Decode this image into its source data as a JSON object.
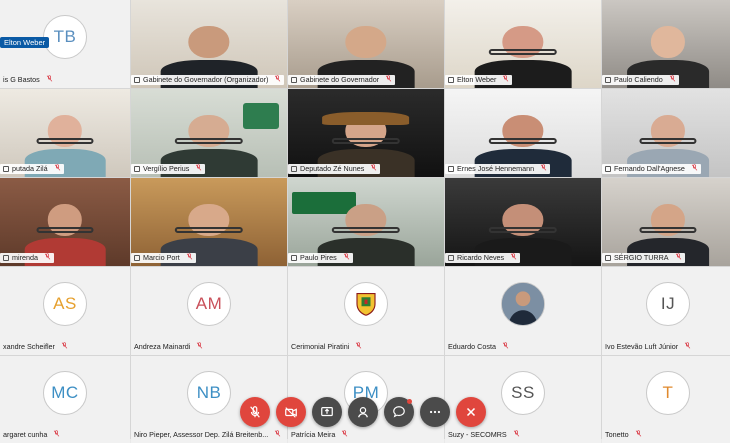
{
  "active_speaker_badge": "Elton Weber",
  "participants": [
    {
      "name": "is G Bastos",
      "kind": "avatar",
      "initials": "TB",
      "color": "#5a8fbf",
      "row": 1,
      "col": 1
    },
    {
      "name": "Gabinete do Governador (Organizador)",
      "kind": "video",
      "scene": "office",
      "device": "laptop",
      "row": 1,
      "col": 2
    },
    {
      "name": "Gabinete do Governador",
      "kind": "video",
      "scene": "room",
      "device": "phone",
      "row": 1,
      "col": 3
    },
    {
      "name": "Elton Weber",
      "kind": "video",
      "scene": "bright",
      "device": "phone",
      "active": true,
      "row": 1,
      "col": 4
    },
    {
      "name": "Paulo Caliendo",
      "kind": "video",
      "scene": "suit",
      "device": "phone",
      "row": 1,
      "col": 5
    },
    {
      "name": "putada Zilá",
      "kind": "video",
      "scene": "woman",
      "device": "phone",
      "row": 2,
      "col": 1
    },
    {
      "name": "Vergílio Perius",
      "kind": "video",
      "scene": "logo",
      "device": "phone",
      "row": 2,
      "col": 2
    },
    {
      "name": "Deputado Zé Nunes",
      "kind": "video",
      "scene": "hat",
      "device": "phone",
      "row": 2,
      "col": 3
    },
    {
      "name": "Ernes José Hennemann",
      "kind": "video",
      "scene": "white",
      "device": "phone",
      "row": 2,
      "col": 4
    },
    {
      "name": "Fernando Dall'Agnese",
      "kind": "video",
      "scene": "grey",
      "device": "phone",
      "row": 2,
      "col": 5
    },
    {
      "name": "mirenda",
      "kind": "video",
      "scene": "red",
      "device": "phone",
      "row": 3,
      "col": 1
    },
    {
      "name": "Marcio Port",
      "kind": "video",
      "scene": "wood",
      "device": "phone",
      "row": 3,
      "col": 2
    },
    {
      "name": "Paulo Pires",
      "kind": "video",
      "scene": "fecoagro",
      "device": "phone",
      "row": 3,
      "col": 3
    },
    {
      "name": "Ricardo Neves",
      "kind": "video",
      "scene": "dark",
      "device": "phone",
      "row": 3,
      "col": 4
    },
    {
      "name": "SÉRGIO TURRA",
      "kind": "video",
      "scene": "shelf",
      "device": "phone",
      "row": 3,
      "col": 5
    },
    {
      "name": "xandre Scheifler",
      "kind": "avatar",
      "initials": "AS",
      "color": "#e6a02e",
      "row": 4,
      "col": 1
    },
    {
      "name": "Andreza Mainardi",
      "kind": "avatar",
      "initials": "AM",
      "color": "#c9505a",
      "row": 4,
      "col": 2
    },
    {
      "name": "Cerimonial Piratini",
      "kind": "crest",
      "initials": "",
      "color": "#2e7d32",
      "row": 4,
      "col": 3
    },
    {
      "name": "Eduardo Costa",
      "kind": "photo",
      "initials": "",
      "color": "#6b7f93",
      "row": 4,
      "col": 4
    },
    {
      "name": "Ivo Estevão Luft Júnior",
      "kind": "avatar",
      "initials": "IJ",
      "color": "#555555",
      "row": 4,
      "col": 5
    },
    {
      "name": "argaret cunha",
      "kind": "avatar",
      "initials": "MC",
      "color": "#3d8fc4",
      "row": 5,
      "col": 1
    },
    {
      "name": "Niro Pieper, Assessor Dep. Zilá Breitenb...",
      "kind": "avatar",
      "initials": "NB",
      "color": "#3d8fc4",
      "row": 5,
      "col": 2
    },
    {
      "name": "Patrícia Meira",
      "kind": "avatar",
      "initials": "PM",
      "color": "#3d8fc4",
      "row": 5,
      "col": 3
    },
    {
      "name": "Suzy - SECOMRS",
      "kind": "avatar",
      "initials": "SS",
      "color": "#555555",
      "row": 5,
      "col": 4
    },
    {
      "name": "Tonetto",
      "kind": "avatar",
      "initials": "T",
      "color": "#e08a2e",
      "row": 5,
      "col": 5
    }
  ],
  "toolbar": [
    {
      "id": "mute",
      "icon": "mic-off-icon",
      "style": "red"
    },
    {
      "id": "video",
      "icon": "video-off-icon",
      "style": "red"
    },
    {
      "id": "share",
      "icon": "share-screen-icon",
      "style": "gray"
    },
    {
      "id": "participants",
      "icon": "participants-icon",
      "style": "gray"
    },
    {
      "id": "chat",
      "icon": "chat-icon",
      "style": "gray",
      "notify": true
    },
    {
      "id": "more",
      "icon": "more-icon",
      "style": "gray"
    },
    {
      "id": "leave",
      "icon": "leave-icon",
      "style": "red"
    }
  ]
}
